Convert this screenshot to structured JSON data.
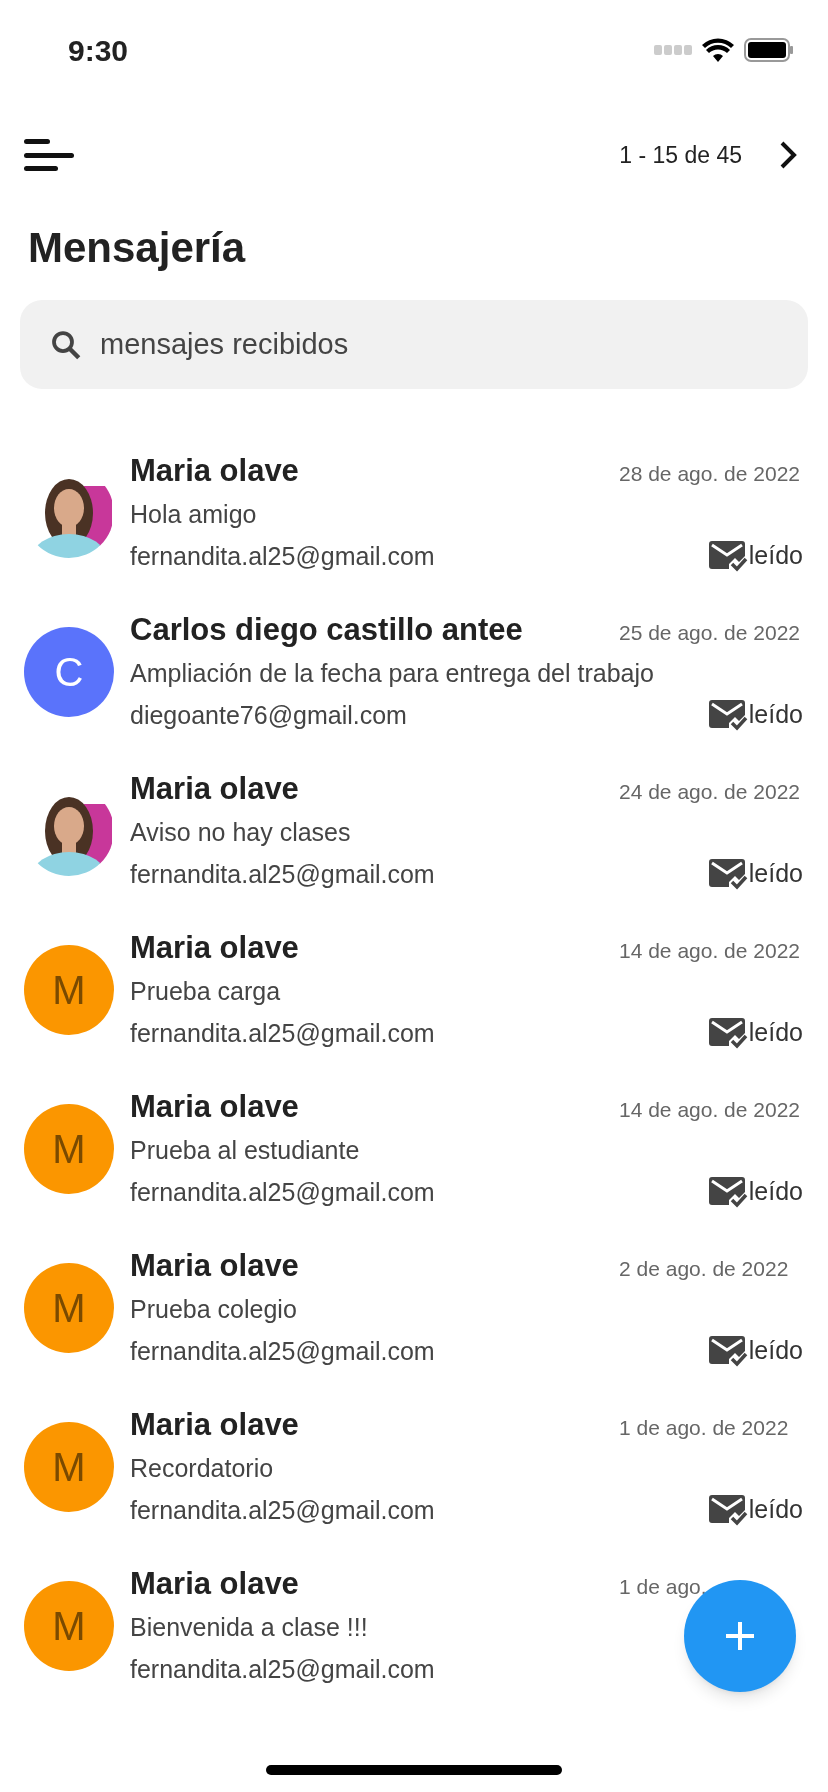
{
  "status_bar": {
    "time": "9:30"
  },
  "header": {
    "pagination": "1 - 15 de 45",
    "title": "Mensajería"
  },
  "search": {
    "value": "mensajes recibidos"
  },
  "messages": [
    {
      "name": "Maria olave",
      "date": "28 de ago. de 2022",
      "subject": "Hola amigo",
      "email": "fernandita.al25@gmail.com",
      "status": "leído"
    },
    {
      "avatar": {
        "kind": "letter",
        "letter": "C",
        "color": "#5a73fb"
      },
      "name": "Carlos diego castillo antee",
      "date": "25 de ago. de 2022",
      "subject": "Ampliación de la fecha para entrega del trabajo",
      "email": "diegoante76@gmail.com",
      "status": "leído"
    },
    {
      "name": "Maria olave",
      "date": "24 de ago. de 2022",
      "subject": "Aviso no hay clases",
      "email": "fernandita.al25@gmail.com",
      "status": "leído"
    },
    {
      "avatar": {
        "kind": "letter",
        "letter": "M",
        "color": "#fb9600"
      },
      "name": "Maria olave",
      "date": "14 de ago. de 2022",
      "subject": "Prueba carga",
      "email": "fernandita.al25@gmail.com",
      "status": "leído"
    },
    {
      "avatar": {
        "kind": "letter",
        "letter": "M",
        "color": "#fb9600"
      },
      "name": "Maria olave",
      "date": "14 de ago. de 2022",
      "subject": "Prueba al estudiante",
      "email": "fernandita.al25@gmail.com",
      "status": "leído"
    },
    {
      "avatar": {
        "kind": "letter",
        "letter": "M",
        "color": "#fb9600"
      },
      "name": "Maria olave",
      "date": "2 de ago. de 2022",
      "subject": "Prueba colegio",
      "email": "fernandita.al25@gmail.com",
      "status": "leído"
    },
    {
      "avatar": {
        "kind": "letter",
        "letter": "M",
        "color": "#fb9600"
      },
      "name": "Maria olave",
      "date": "1 de ago. de 2022",
      "subject": "Recordatorio",
      "email": "fernandita.al25@gmail.com",
      "status": "leído"
    },
    {
      "avatar": {
        "kind": "letter",
        "letter": "M",
        "color": "#fb9600"
      },
      "name": "Maria olave",
      "date": "1 de ago.",
      "subject": "Bienvenida a clase !!!",
      "email": "fernandita.al25@gmail.com"
    }
  ]
}
